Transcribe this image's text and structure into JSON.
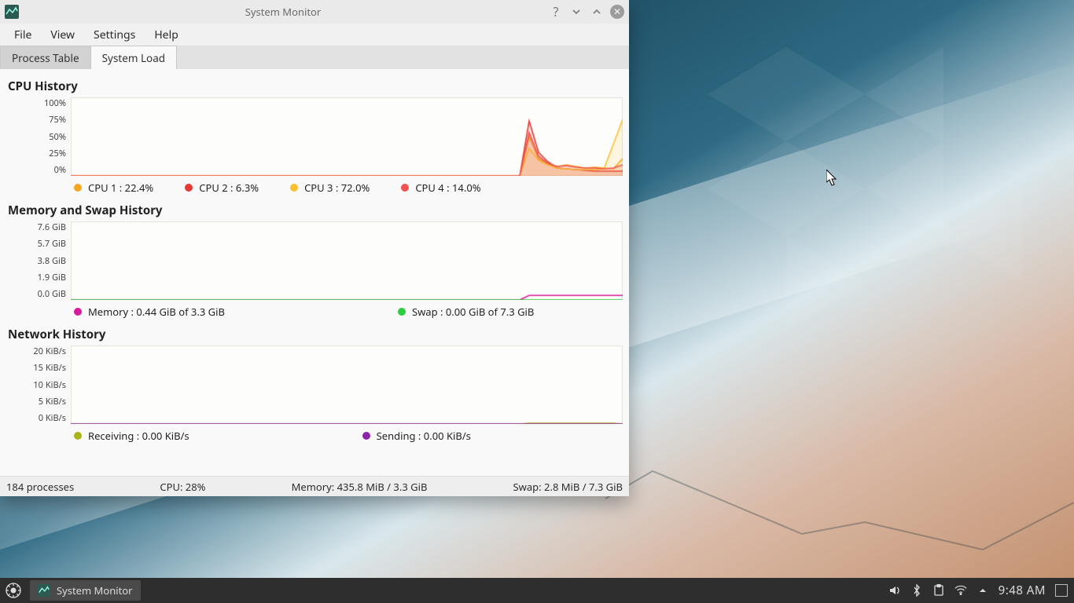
{
  "window": {
    "title": "System Monitor",
    "menus": {
      "file": "File",
      "view": "View",
      "settings": "Settings",
      "help": "Help"
    },
    "tabs": {
      "process": "Process Table",
      "load": "System Load"
    }
  },
  "chart_data": [
    {
      "type": "line",
      "title": "CPU History",
      "ylabel": "%",
      "ylim": [
        0,
        100
      ],
      "yticks": [
        "100%",
        "75%",
        "50%",
        "25%",
        "0%"
      ],
      "x": [
        0,
        1,
        2,
        3,
        4,
        5,
        6,
        7,
        8,
        9,
        10,
        11,
        12,
        13,
        14,
        15,
        16,
        17,
        18,
        19,
        20,
        21,
        22,
        23,
        24,
        25,
        26,
        27,
        28,
        29,
        30,
        31,
        32,
        33,
        34,
        35,
        36,
        37,
        38,
        39,
        40,
        41,
        42,
        43,
        44,
        45,
        46,
        47,
        48,
        49,
        50,
        51,
        52,
        53,
        54,
        55,
        56,
        57,
        58,
        59
      ],
      "series": [
        {
          "name": "CPU 1",
          "current": 22.4,
          "color": "#f5a623",
          "values": [
            0,
            0,
            0,
            0,
            0,
            0,
            0,
            0,
            0,
            0,
            0,
            0,
            0,
            0,
            0,
            0,
            0,
            0,
            0,
            0,
            0,
            0,
            0,
            0,
            0,
            0,
            0,
            0,
            0,
            0,
            0,
            0,
            0,
            0,
            0,
            0,
            0,
            0,
            0,
            0,
            0,
            0,
            0,
            0,
            0,
            0,
            0,
            0,
            0,
            50,
            22,
            15,
            12,
            14,
            12,
            10,
            11,
            10,
            9,
            22
          ]
        },
        {
          "name": "CPU 2",
          "current": 6.3,
          "color": "#e53935",
          "values": [
            0,
            0,
            0,
            0,
            0,
            0,
            0,
            0,
            0,
            0,
            0,
            0,
            0,
            0,
            0,
            0,
            0,
            0,
            0,
            0,
            0,
            0,
            0,
            0,
            0,
            0,
            0,
            0,
            0,
            0,
            0,
            0,
            0,
            0,
            0,
            0,
            0,
            0,
            0,
            0,
            0,
            0,
            0,
            0,
            0,
            0,
            0,
            0,
            0,
            70,
            30,
            18,
            10,
            9,
            8,
            7,
            6,
            6,
            6,
            6
          ]
        },
        {
          "name": "CPU 3",
          "current": 72.0,
          "color": "#fbc02d",
          "values": [
            0,
            0,
            0,
            0,
            0,
            0,
            0,
            0,
            0,
            0,
            0,
            0,
            0,
            0,
            0,
            0,
            0,
            0,
            0,
            0,
            0,
            0,
            0,
            0,
            0,
            0,
            0,
            0,
            0,
            0,
            0,
            0,
            0,
            0,
            0,
            0,
            0,
            0,
            0,
            0,
            0,
            0,
            0,
            0,
            0,
            0,
            0,
            0,
            0,
            35,
            20,
            14,
            10,
            9,
            8,
            8,
            8,
            9,
            40,
            72
          ]
        },
        {
          "name": "CPU 4",
          "current": 14.0,
          "color": "#ef5350",
          "values": [
            0,
            0,
            0,
            0,
            0,
            0,
            0,
            0,
            0,
            0,
            0,
            0,
            0,
            0,
            0,
            0,
            0,
            0,
            0,
            0,
            0,
            0,
            0,
            0,
            0,
            0,
            0,
            0,
            0,
            0,
            0,
            0,
            0,
            0,
            0,
            0,
            0,
            0,
            0,
            0,
            0,
            0,
            0,
            0,
            0,
            0,
            0,
            0,
            0,
            55,
            25,
            16,
            12,
            13,
            11,
            10,
            10,
            9,
            10,
            14
          ]
        }
      ]
    },
    {
      "type": "line",
      "title": "Memory and Swap History",
      "ylabel": "GiB",
      "ylim": [
        0,
        7.6
      ],
      "yticks": [
        "7.6 GiB",
        "5.7 GiB",
        "3.8 GiB",
        "1.9 GiB",
        "0.0 GiB"
      ],
      "x": [
        0,
        1,
        2,
        3,
        4,
        5,
        6,
        7,
        8,
        9,
        10,
        11,
        12,
        13,
        14,
        15,
        16,
        17,
        18,
        19,
        20,
        21,
        22,
        23,
        24,
        25,
        26,
        27,
        28,
        29,
        30,
        31,
        32,
        33,
        34,
        35,
        36,
        37,
        38,
        39,
        40,
        41,
        42,
        43,
        44,
        45,
        46,
        47,
        48,
        49,
        50,
        51,
        52,
        53,
        54,
        55,
        56,
        57,
        58,
        59
      ],
      "series": [
        {
          "name": "Memory",
          "current_gib": 0.44,
          "total_gib": 3.3,
          "color": "#d81b9a",
          "values": [
            0,
            0,
            0,
            0,
            0,
            0,
            0,
            0,
            0,
            0,
            0,
            0,
            0,
            0,
            0,
            0,
            0,
            0,
            0,
            0,
            0,
            0,
            0,
            0,
            0,
            0,
            0,
            0,
            0,
            0,
            0,
            0,
            0,
            0,
            0,
            0,
            0,
            0,
            0,
            0,
            0,
            0,
            0,
            0,
            0,
            0,
            0,
            0,
            0,
            0.44,
            0.44,
            0.44,
            0.44,
            0.44,
            0.44,
            0.44,
            0.44,
            0.44,
            0.44,
            0.44
          ]
        },
        {
          "name": "Swap",
          "current_gib": 0.0,
          "total_gib": 7.3,
          "color": "#2ecc40",
          "values": [
            0,
            0,
            0,
            0,
            0,
            0,
            0,
            0,
            0,
            0,
            0,
            0,
            0,
            0,
            0,
            0,
            0,
            0,
            0,
            0,
            0,
            0,
            0,
            0,
            0,
            0,
            0,
            0,
            0,
            0,
            0,
            0,
            0,
            0,
            0,
            0,
            0,
            0,
            0,
            0,
            0,
            0,
            0,
            0,
            0,
            0,
            0,
            0,
            0,
            0.0028,
            0.0028,
            0.0028,
            0.0028,
            0.0028,
            0.0028,
            0.0028,
            0.0028,
            0.0028,
            0.0028,
            0.0028
          ]
        }
      ]
    },
    {
      "type": "line",
      "title": "Network History",
      "ylabel": "KiB/s",
      "ylim": [
        0,
        20
      ],
      "yticks": [
        "20 KiB/s",
        "15 KiB/s",
        "10 KiB/s",
        "5 KiB/s",
        "0 KiB/s"
      ],
      "x": [
        0,
        1,
        2,
        3,
        4,
        5,
        6,
        7,
        8,
        9,
        10,
        11,
        12,
        13,
        14,
        15,
        16,
        17,
        18,
        19,
        20,
        21,
        22,
        23,
        24,
        25,
        26,
        27,
        28,
        29,
        30,
        31,
        32,
        33,
        34,
        35,
        36,
        37,
        38,
        39,
        40,
        41,
        42,
        43,
        44,
        45,
        46,
        47,
        48,
        49,
        50,
        51,
        52,
        53,
        54,
        55,
        56,
        57,
        58,
        59
      ],
      "series": [
        {
          "name": "Receiving",
          "current": 0.0,
          "color": "#aab418",
          "values": [
            0,
            0,
            0,
            0,
            0,
            0,
            0,
            0,
            0,
            0,
            0,
            0,
            0,
            0,
            0,
            0,
            0,
            0,
            0,
            0,
            0,
            0,
            0,
            0,
            0,
            0,
            0,
            0,
            0,
            0,
            0,
            0,
            0,
            0,
            0,
            0,
            0,
            0,
            0,
            0,
            0,
            0,
            0,
            0,
            0,
            0,
            0,
            0,
            0,
            0.2,
            0.2,
            0.2,
            0.2,
            0.2,
            0.2,
            0.2,
            0.2,
            0.2,
            0.2,
            0.0
          ]
        },
        {
          "name": "Sending",
          "current": 0.0,
          "color": "#8e24aa",
          "values": [
            0,
            0,
            0,
            0,
            0,
            0,
            0,
            0,
            0,
            0,
            0,
            0,
            0,
            0,
            0,
            0,
            0,
            0,
            0,
            0,
            0,
            0,
            0,
            0,
            0,
            0,
            0,
            0,
            0,
            0,
            0,
            0,
            0,
            0,
            0,
            0,
            0,
            0,
            0,
            0,
            0,
            0,
            0,
            0,
            0,
            0,
            0,
            0,
            0,
            0.0,
            0.0,
            0.0,
            0.0,
            0.0,
            0.0,
            0.0,
            0.0,
            0.0,
            0.0,
            0.0
          ]
        }
      ]
    }
  ],
  "legends": {
    "cpu": [
      {
        "label": "CPU 1 : 22.4%",
        "color": "#f5a623"
      },
      {
        "label": "CPU 2 : 6.3%",
        "color": "#e53935"
      },
      {
        "label": "CPU 3 : 72.0%",
        "color": "#fbc02d"
      },
      {
        "label": "CPU 4 : 14.0%",
        "color": "#ef5350"
      }
    ],
    "mem": [
      {
        "label": "Memory : 0.44 GiB of 3.3 GiB",
        "color": "#d81b9a"
      },
      {
        "label": "Swap : 0.00 GiB of 7.3 GiB",
        "color": "#2ecc40"
      }
    ],
    "net": [
      {
        "label": "Receiving : 0.00 KiB/s",
        "color": "#aab418"
      },
      {
        "label": "Sending : 0.00 KiB/s",
        "color": "#8e24aa"
      }
    ]
  },
  "statusbar": {
    "processes": "184 processes",
    "cpu": "CPU: 28%",
    "memory": "Memory: 435.8 MiB / 3.3 GiB",
    "swap": "Swap: 2.8 MiB / 7.3 GiB"
  },
  "taskbar": {
    "task_label": "System Monitor",
    "clock": "9:48 AM"
  }
}
